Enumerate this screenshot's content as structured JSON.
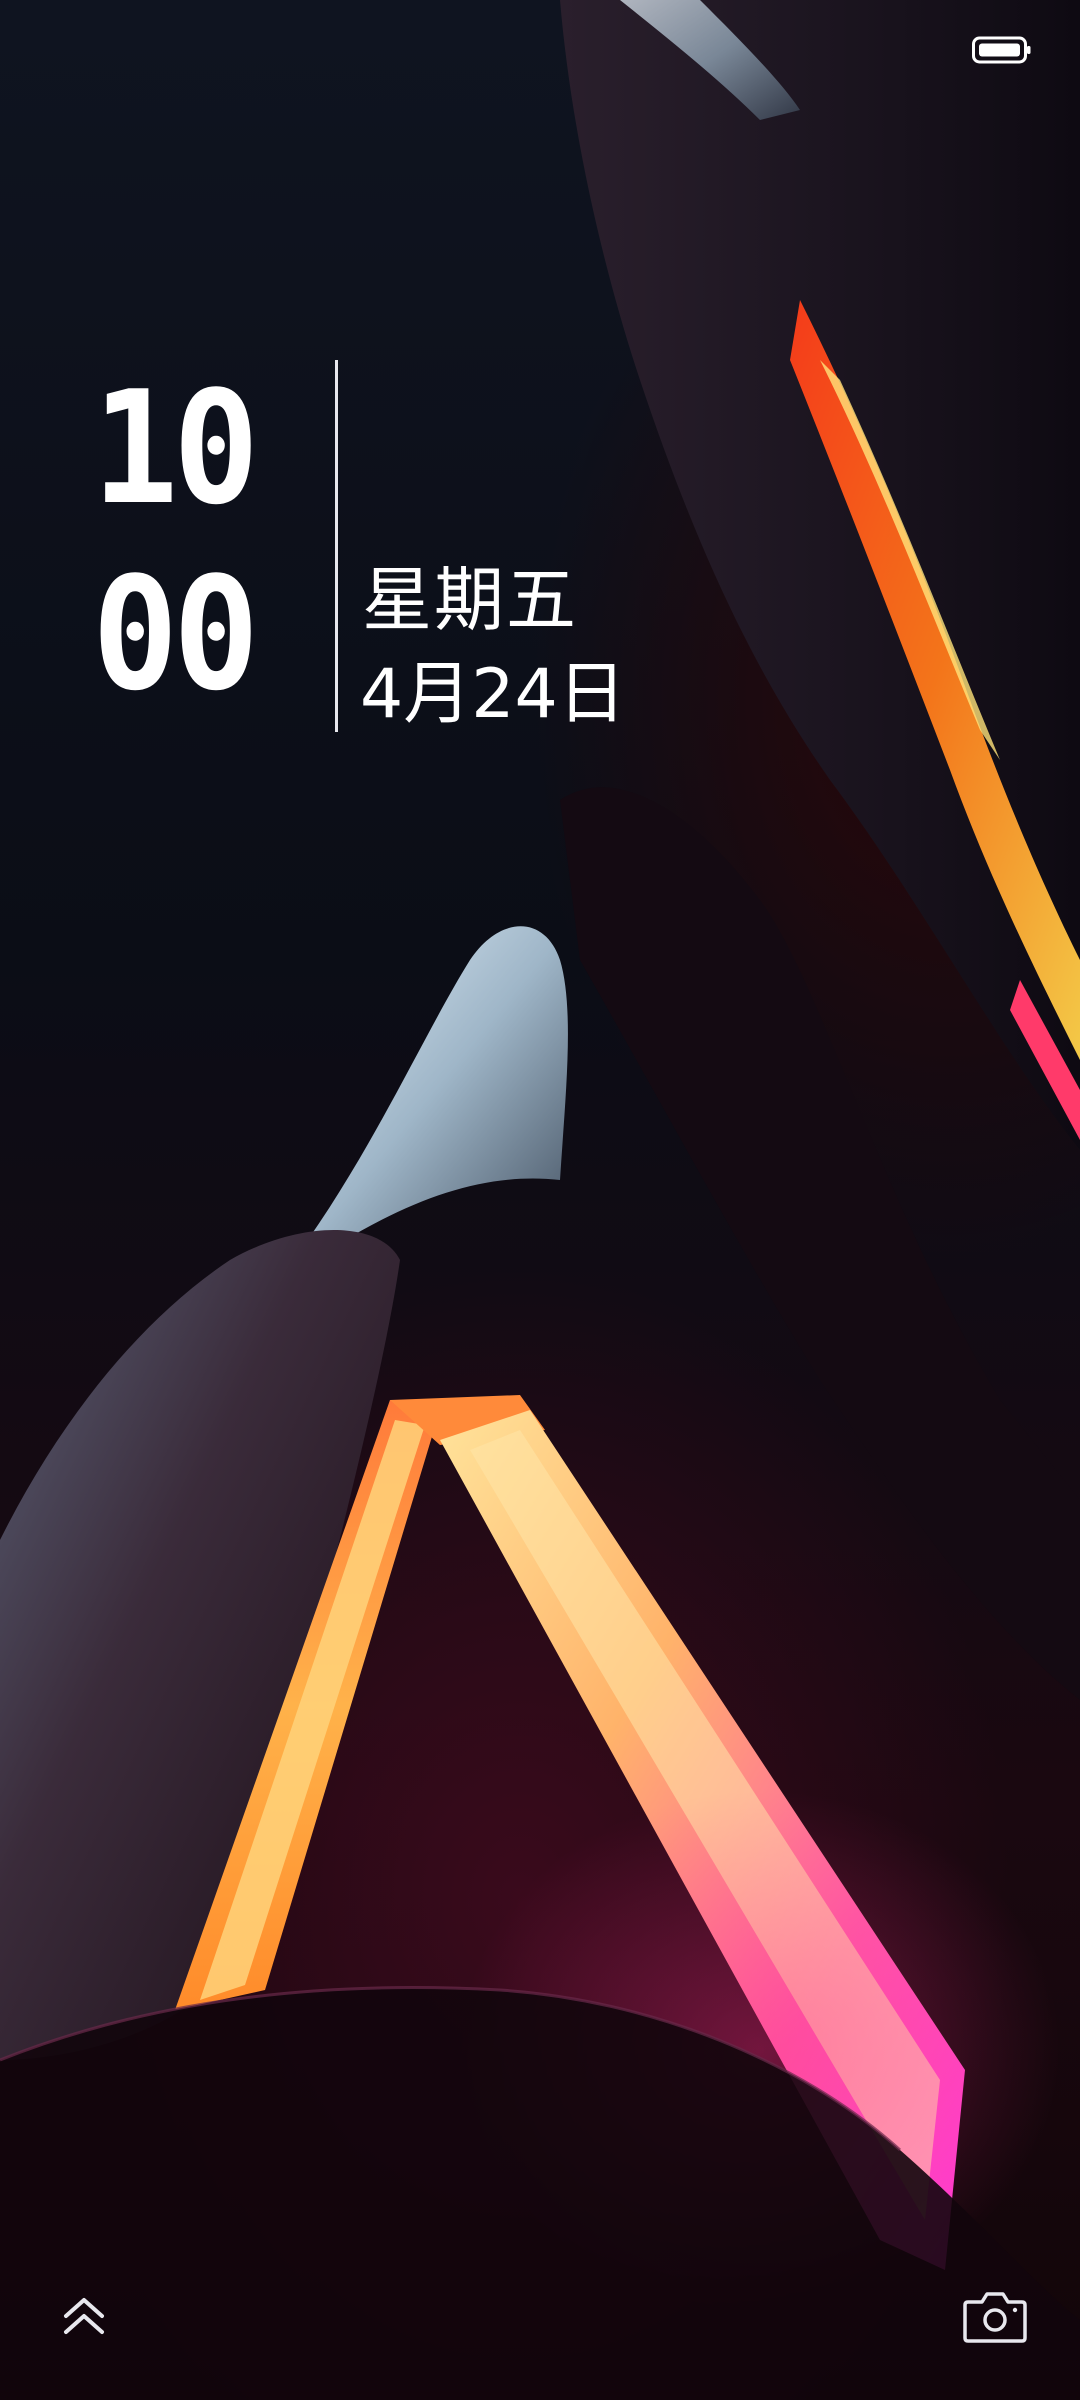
{
  "status_bar": {
    "battery_icon": "battery-full-icon",
    "battery_level": 1.0
  },
  "clock": {
    "hours": "10",
    "minutes": "00"
  },
  "date": {
    "weekday": "星期五",
    "date": "4月24日"
  },
  "shortcuts": {
    "unlock_icon": "double-chevron-up-icon",
    "camera_icon": "camera-icon"
  },
  "colors": {
    "text": "#ffffff",
    "accent_orange": "#ff6a1a",
    "accent_yellow": "#ffe27a",
    "accent_pink": "#ff3fcf"
  }
}
